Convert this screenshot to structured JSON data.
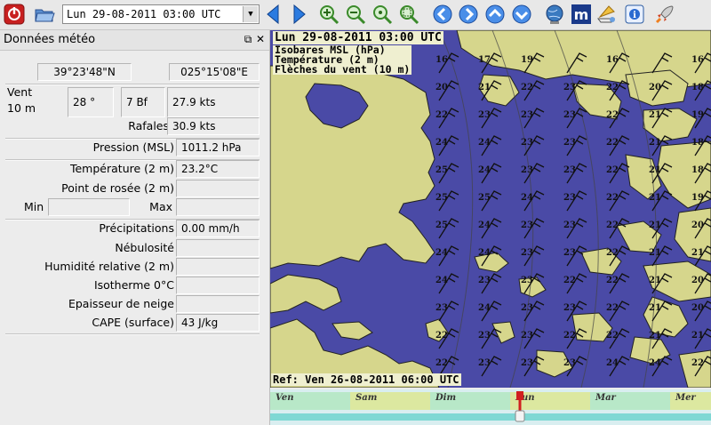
{
  "toolbar": {
    "date_value": "Lun 29-08-2011 03:00 UTC",
    "buttons": [
      "power-icon",
      "open-folder-icon",
      "prev-arrow-icon",
      "next-arrow-icon",
      "zoom-in-icon",
      "zoom-out-icon",
      "zoom-fit-icon",
      "zoom-selection-icon",
      "pan-left-icon",
      "pan-right-icon",
      "pan-up-icon",
      "pan-down-icon",
      "globe-icon",
      "meteotable-icon",
      "boat-icon",
      "info-icon",
      "rocket-icon"
    ]
  },
  "panel": {
    "title": "Données météo",
    "detach": "⧉",
    "close": "✕",
    "lat": "39°23'48\"N",
    "lon": "025°15'08\"E",
    "wind_label_1": "Vent",
    "wind_label_2": "10 m",
    "wind_dir": "28 °",
    "wind_bf": "7 Bf",
    "wind_speed": "27.9  kts",
    "gusts_label": "Rafales",
    "gusts_value": "30.9  kts",
    "pressure_label": "Pression (MSL)",
    "pressure_value": "1011.2 hPa",
    "temp_label": "Température (2 m)",
    "temp_value": "23.2°C",
    "dew_label": "Point de rosée (2 m)",
    "dew_value": "",
    "min_label": "Min",
    "min_value": "",
    "max_label": "Max",
    "max_value": "",
    "precip_label": "Précipitations",
    "precip_value": "0.00 mm/h",
    "cloud_label": "Nébulosité",
    "cloud_value": "",
    "humidity_label": "Humidité relative (2 m)",
    "humidity_value": "",
    "iso_label": "Isotherme 0°C",
    "iso_value": "",
    "snow_label": "Epaisseur de neige",
    "snow_value": "",
    "cape_label": "CAPE (surface)",
    "cape_value": "43 J/kg"
  },
  "map": {
    "date": "Lun 29-08-2011 03:00 UTC",
    "layer_1": "Isobares MSL (hPa)",
    "layer_2": "Température (2 m)",
    "layer_3": "Flèches du vent (10 m)",
    "ref": "Ref: Ven 26-08-2011 06:00 UTC",
    "colors": {
      "sea": "#4a4aa6",
      "land": "#d6d68c",
      "label_bg": "#efefd0"
    },
    "temps": [
      [
        16,
        17,
        19,
        null,
        16,
        null,
        16
      ],
      [
        20,
        21,
        22,
        23,
        22,
        20,
        18
      ],
      [
        22,
        23,
        23,
        23,
        22,
        21,
        19
      ],
      [
        24,
        24,
        23,
        23,
        22,
        21,
        18
      ],
      [
        25,
        24,
        23,
        23,
        22,
        21,
        18
      ],
      [
        25,
        25,
        24,
        23,
        22,
        21,
        19
      ],
      [
        25,
        24,
        23,
        23,
        22,
        21,
        20
      ],
      [
        24,
        24,
        23,
        23,
        22,
        21,
        21
      ],
      [
        24,
        23,
        23,
        22,
        22,
        21,
        20
      ],
      [
        23,
        24,
        23,
        23,
        22,
        21,
        20
      ],
      [
        22,
        23,
        23,
        22,
        22,
        21,
        21
      ],
      [
        22,
        23,
        23,
        23,
        24,
        24,
        22
      ]
    ]
  },
  "timeline": {
    "days": [
      "Ven",
      "Sam",
      "Dim",
      "Lun",
      "Mar",
      "Mer"
    ]
  }
}
